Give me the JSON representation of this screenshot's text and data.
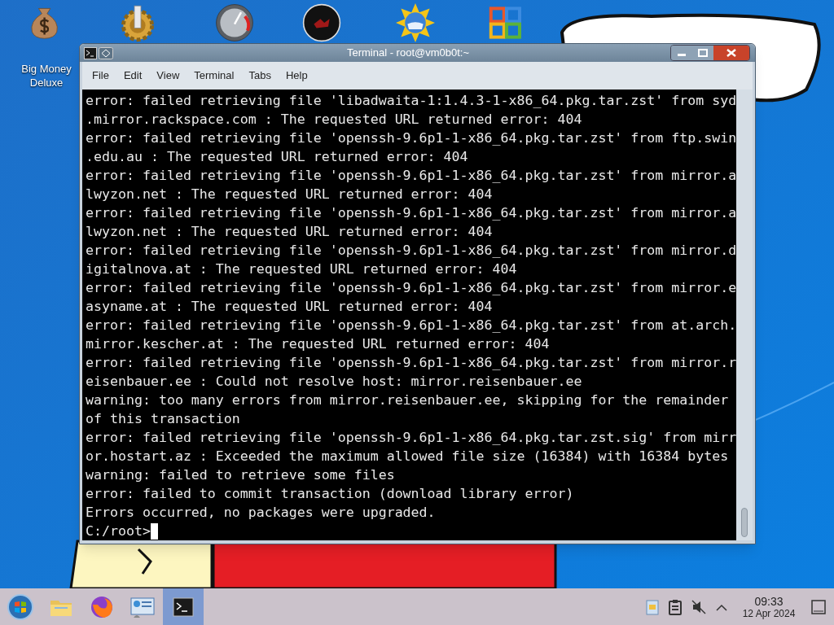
{
  "desktop_icons": [
    {
      "kind": "money-bag",
      "label": "Big Money Deluxe"
    },
    {
      "kind": "gear"
    },
    {
      "kind": "gauge"
    },
    {
      "kind": "dark-disc"
    },
    {
      "kind": "globe"
    },
    {
      "kind": "office"
    }
  ],
  "window": {
    "title": "Terminal - root@vm0b0t:~",
    "menu": [
      "File",
      "Edit",
      "View",
      "Terminal",
      "Tabs",
      "Help"
    ],
    "lines": [
      "error: failed retrieving file 'libadwaita-1:1.4.3-1-x86_64.pkg.tar.zst' from syd",
      ".mirror.rackspace.com : The requested URL returned error: 404",
      "error: failed retrieving file 'openssh-9.6p1-1-x86_64.pkg.tar.zst' from ftp.swin",
      ".edu.au : The requested URL returned error: 404",
      "error: failed retrieving file 'openssh-9.6p1-1-x86_64.pkg.tar.zst' from mirror.a",
      "lwyzon.net : The requested URL returned error: 404",
      "error: failed retrieving file 'openssh-9.6p1-1-x86_64.pkg.tar.zst' from mirror.a",
      "lwyzon.net : The requested URL returned error: 404",
      "error: failed retrieving file 'openssh-9.6p1-1-x86_64.pkg.tar.zst' from mirror.d",
      "igitalnova.at : The requested URL returned error: 404",
      "error: failed retrieving file 'openssh-9.6p1-1-x86_64.pkg.tar.zst' from mirror.e",
      "asyname.at : The requested URL returned error: 404",
      "error: failed retrieving file 'openssh-9.6p1-1-x86_64.pkg.tar.zst' from at.arch.",
      "mirror.kescher.at : The requested URL returned error: 404",
      "error: failed retrieving file 'openssh-9.6p1-1-x86_64.pkg.tar.zst' from mirror.r",
      "eisenbauer.ee : Could not resolve host: mirror.reisenbauer.ee",
      "warning: too many errors from mirror.reisenbauer.ee, skipping for the remainder",
      "of this transaction",
      "error: failed retrieving file 'openssh-9.6p1-1-x86_64.pkg.tar.zst.sig' from mirr",
      "or.hostart.az : Exceeded the maximum allowed file size (16384) with 16384 bytes",
      "warning: failed to retrieve some files",
      "error: failed to commit transaction (download library error)",
      "Errors occurred, no packages were upgraded."
    ],
    "prompt": "C:/root>"
  },
  "taskbar": {
    "apps": [
      {
        "kind": "start",
        "selected": false
      },
      {
        "kind": "folder",
        "selected": false
      },
      {
        "kind": "browser",
        "selected": false
      },
      {
        "kind": "control-panel",
        "selected": false
      },
      {
        "kind": "terminal",
        "selected": true
      }
    ],
    "tray": {
      "muted": true
    },
    "time": "09:33",
    "date": "12 Apr 2024"
  }
}
